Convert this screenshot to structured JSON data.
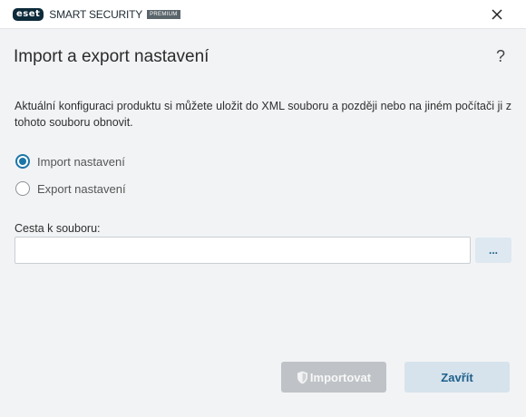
{
  "titlebar": {
    "brand": "eset",
    "product": "SMART SECURITY",
    "edition": "PREMIUM",
    "close_icon": "close-icon"
  },
  "dialog": {
    "title": "Import a export nastavení",
    "help": "?",
    "description": "Aktuální konfiguraci produktu si můžete uložit do XML souboru a později nebo na jiném počítači ji z tohoto souboru obnovit.",
    "options": [
      {
        "label": "Import nastavení",
        "selected": true
      },
      {
        "label": "Export nastavení",
        "selected": false
      }
    ],
    "path": {
      "label": "Cesta k souboru:",
      "value": "",
      "browse_label": "..."
    },
    "buttons": {
      "import_label": "Importovat",
      "import_enabled": false,
      "close_label": "Zavřít"
    }
  },
  "colors": {
    "accent": "#1b76a8",
    "background": "#f2f3f5",
    "disabled_button": "#bfc3c7",
    "secondary_button": "#d6e3ec"
  }
}
